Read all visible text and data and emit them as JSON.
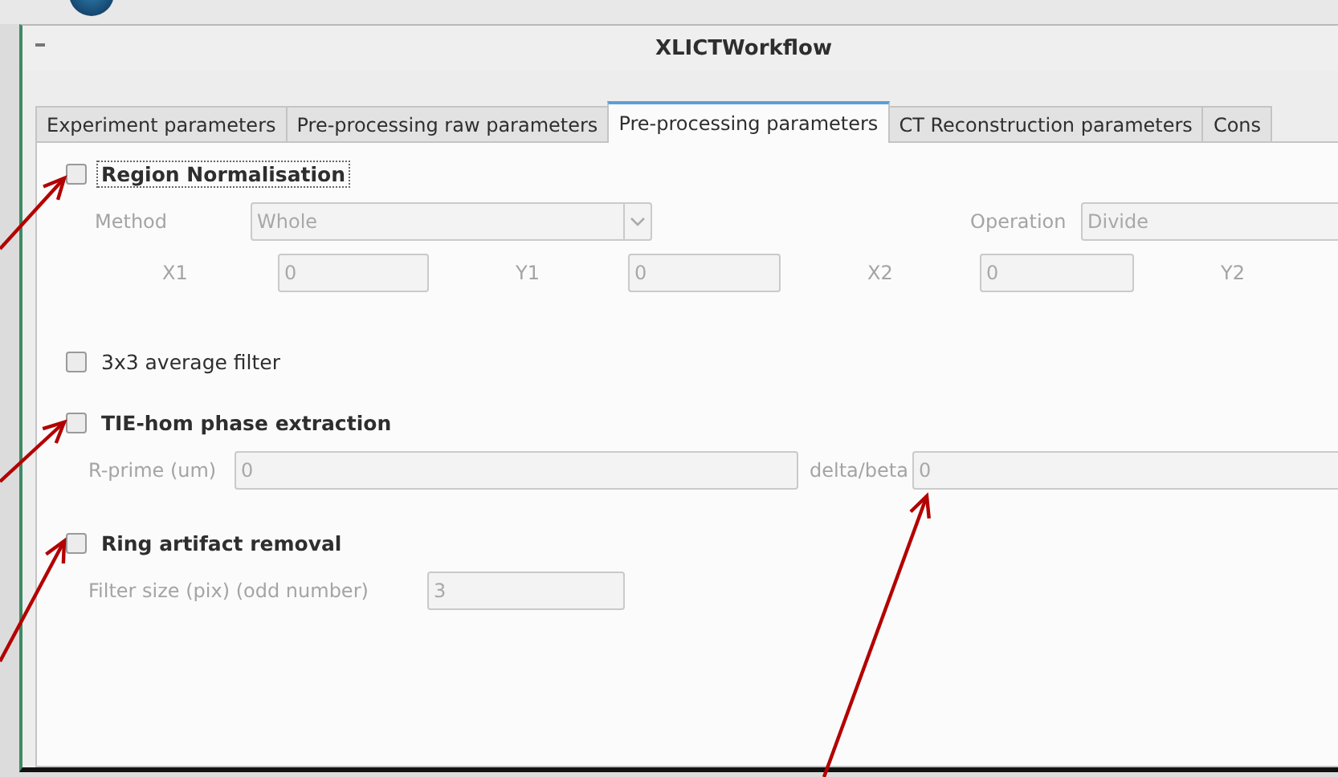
{
  "window": {
    "title": "XLICTWorkflow"
  },
  "tabs": [
    {
      "label": "Experiment parameters",
      "selected": false
    },
    {
      "label": "Pre-processing raw parameters",
      "selected": false
    },
    {
      "label": "Pre-processing parameters",
      "selected": true
    },
    {
      "label": "CT Reconstruction parameters",
      "selected": false
    },
    {
      "label": "Cons",
      "selected": false
    }
  ],
  "options": [
    {
      "label": "Region Normalisation",
      "checked": false,
      "bold": true,
      "focused": true,
      "fields": [
        {
          "label": "Method",
          "kind": "combo",
          "value": "Whole"
        },
        {
          "label": "Operation",
          "kind": "combo",
          "value": "Divide"
        },
        {
          "label": "X1",
          "kind": "text",
          "value": "0"
        },
        {
          "label": "Y1",
          "kind": "text",
          "value": "0"
        },
        {
          "label": "X2",
          "kind": "text",
          "value": "0"
        },
        {
          "label": "Y2"
        }
      ]
    },
    {
      "label": "3x3 average filter",
      "checked": false,
      "bold": false,
      "focused": false
    },
    {
      "label": "TIE-hom phase extraction",
      "checked": false,
      "bold": true,
      "focused": false,
      "fields": [
        {
          "label": "R-prime (um)",
          "kind": "text",
          "value": "0"
        },
        {
          "label": "delta/beta",
          "kind": "text",
          "value": "0"
        }
      ]
    },
    {
      "label": "Ring artifact removal",
      "checked": false,
      "bold": true,
      "focused": false,
      "fields": [
        {
          "label": "Filter size (pix) (odd number)",
          "kind": "text",
          "value": "3"
        }
      ]
    }
  ]
}
